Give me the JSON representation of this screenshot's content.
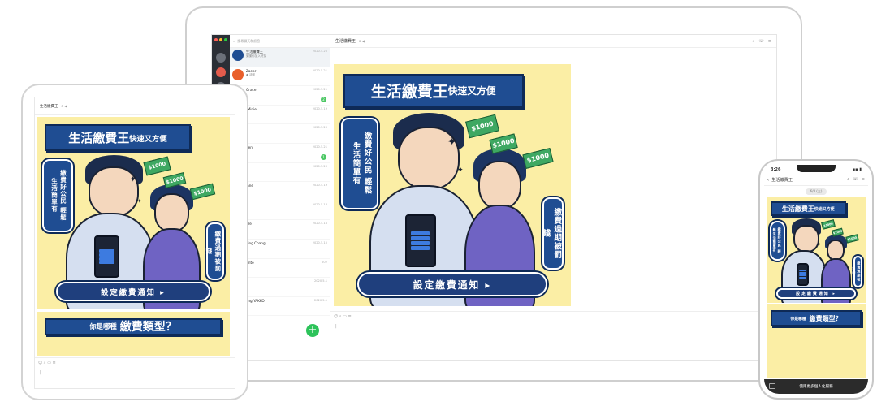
{
  "chat": {
    "name": "生活繳費王",
    "icons": "a ◀"
  },
  "search": {
    "placeholder": "搜尋聊天和訊息"
  },
  "chat_list": [
    {
      "name": "生活繳費王",
      "date": "2020.5.25",
      "preview": "謝謝你加入好友",
      "color": "#1f4d92",
      "badge": ""
    },
    {
      "name": "Zaepr!",
      "date": "2020.5.21",
      "preview": "◆ 活動",
      "color": "#e95f2b",
      "badge": ""
    },
    {
      "name": "Grace",
      "date": "2020.5.21",
      "preview": "",
      "color": "#c9a06a",
      "badge": "2"
    },
    {
      "name": "(Minie)",
      "date": "2020.5.19",
      "preview": "",
      "color": "#7b8da8",
      "badge": ""
    },
    {
      "name": "",
      "date": "2020.5.20",
      "preview": "",
      "color": "#9b8fd6",
      "badge": ""
    },
    {
      "name": "gen",
      "date": "2020.5.21",
      "preview": "",
      "color": "#d9b26a",
      "badge": "1"
    },
    {
      "name": "",
      "date": "2020.5.20",
      "preview": "",
      "color": "#77a9c7",
      "badge": ""
    },
    {
      "name": "lane",
      "date": "2020.5.19",
      "preview": "",
      "color": "#b87fb3",
      "badge": ""
    },
    {
      "name": "",
      "date": "2020.5.18",
      "preview": "",
      "color": "#e7a54f",
      "badge": ""
    },
    {
      "name": "ere",
      "date": "2020.5.16",
      "preview": "",
      "color": "#888",
      "badge": ""
    },
    {
      "name": "Ling Chang",
      "date": "2020.5.15",
      "preview": "",
      "color": "#5ba376",
      "badge": ""
    },
    {
      "name": "Ante",
      "date": "202",
      "preview": "",
      "color": "#cc6b6b",
      "badge": ""
    },
    {
      "name": "",
      "date": "2020.5.1",
      "preview": "",
      "color": "#6a7fbf",
      "badge": ""
    },
    {
      "name": "ling YAKKO",
      "date": "2020.5.1",
      "preview": "",
      "color": "#a7c76a",
      "badge": ""
    }
  ],
  "tools": {
    "icons": "☺ ⌕ ▭ ≡"
  },
  "banner": {
    "title_big": "生活繳費王",
    "title_small": "快速又方便",
    "vertical_left": "繳費好公民 輕鬆生活簡單有",
    "vertical_right": "繳費過期被罰錢",
    "cta": "設定繳費通知 ▸",
    "bill": "$1000"
  },
  "banner2": {
    "title_a": "你是哪種",
    "title_b": "繳費類型？"
  },
  "phone": {
    "time": "3:26",
    "signal": "▪▪ ▮",
    "date": "6/8 (三)",
    "menu": "使用更多個人化服務"
  },
  "colors": {
    "brand": "#1f4d92",
    "bg": "#fbeea5",
    "line_green": "#4cc764"
  }
}
